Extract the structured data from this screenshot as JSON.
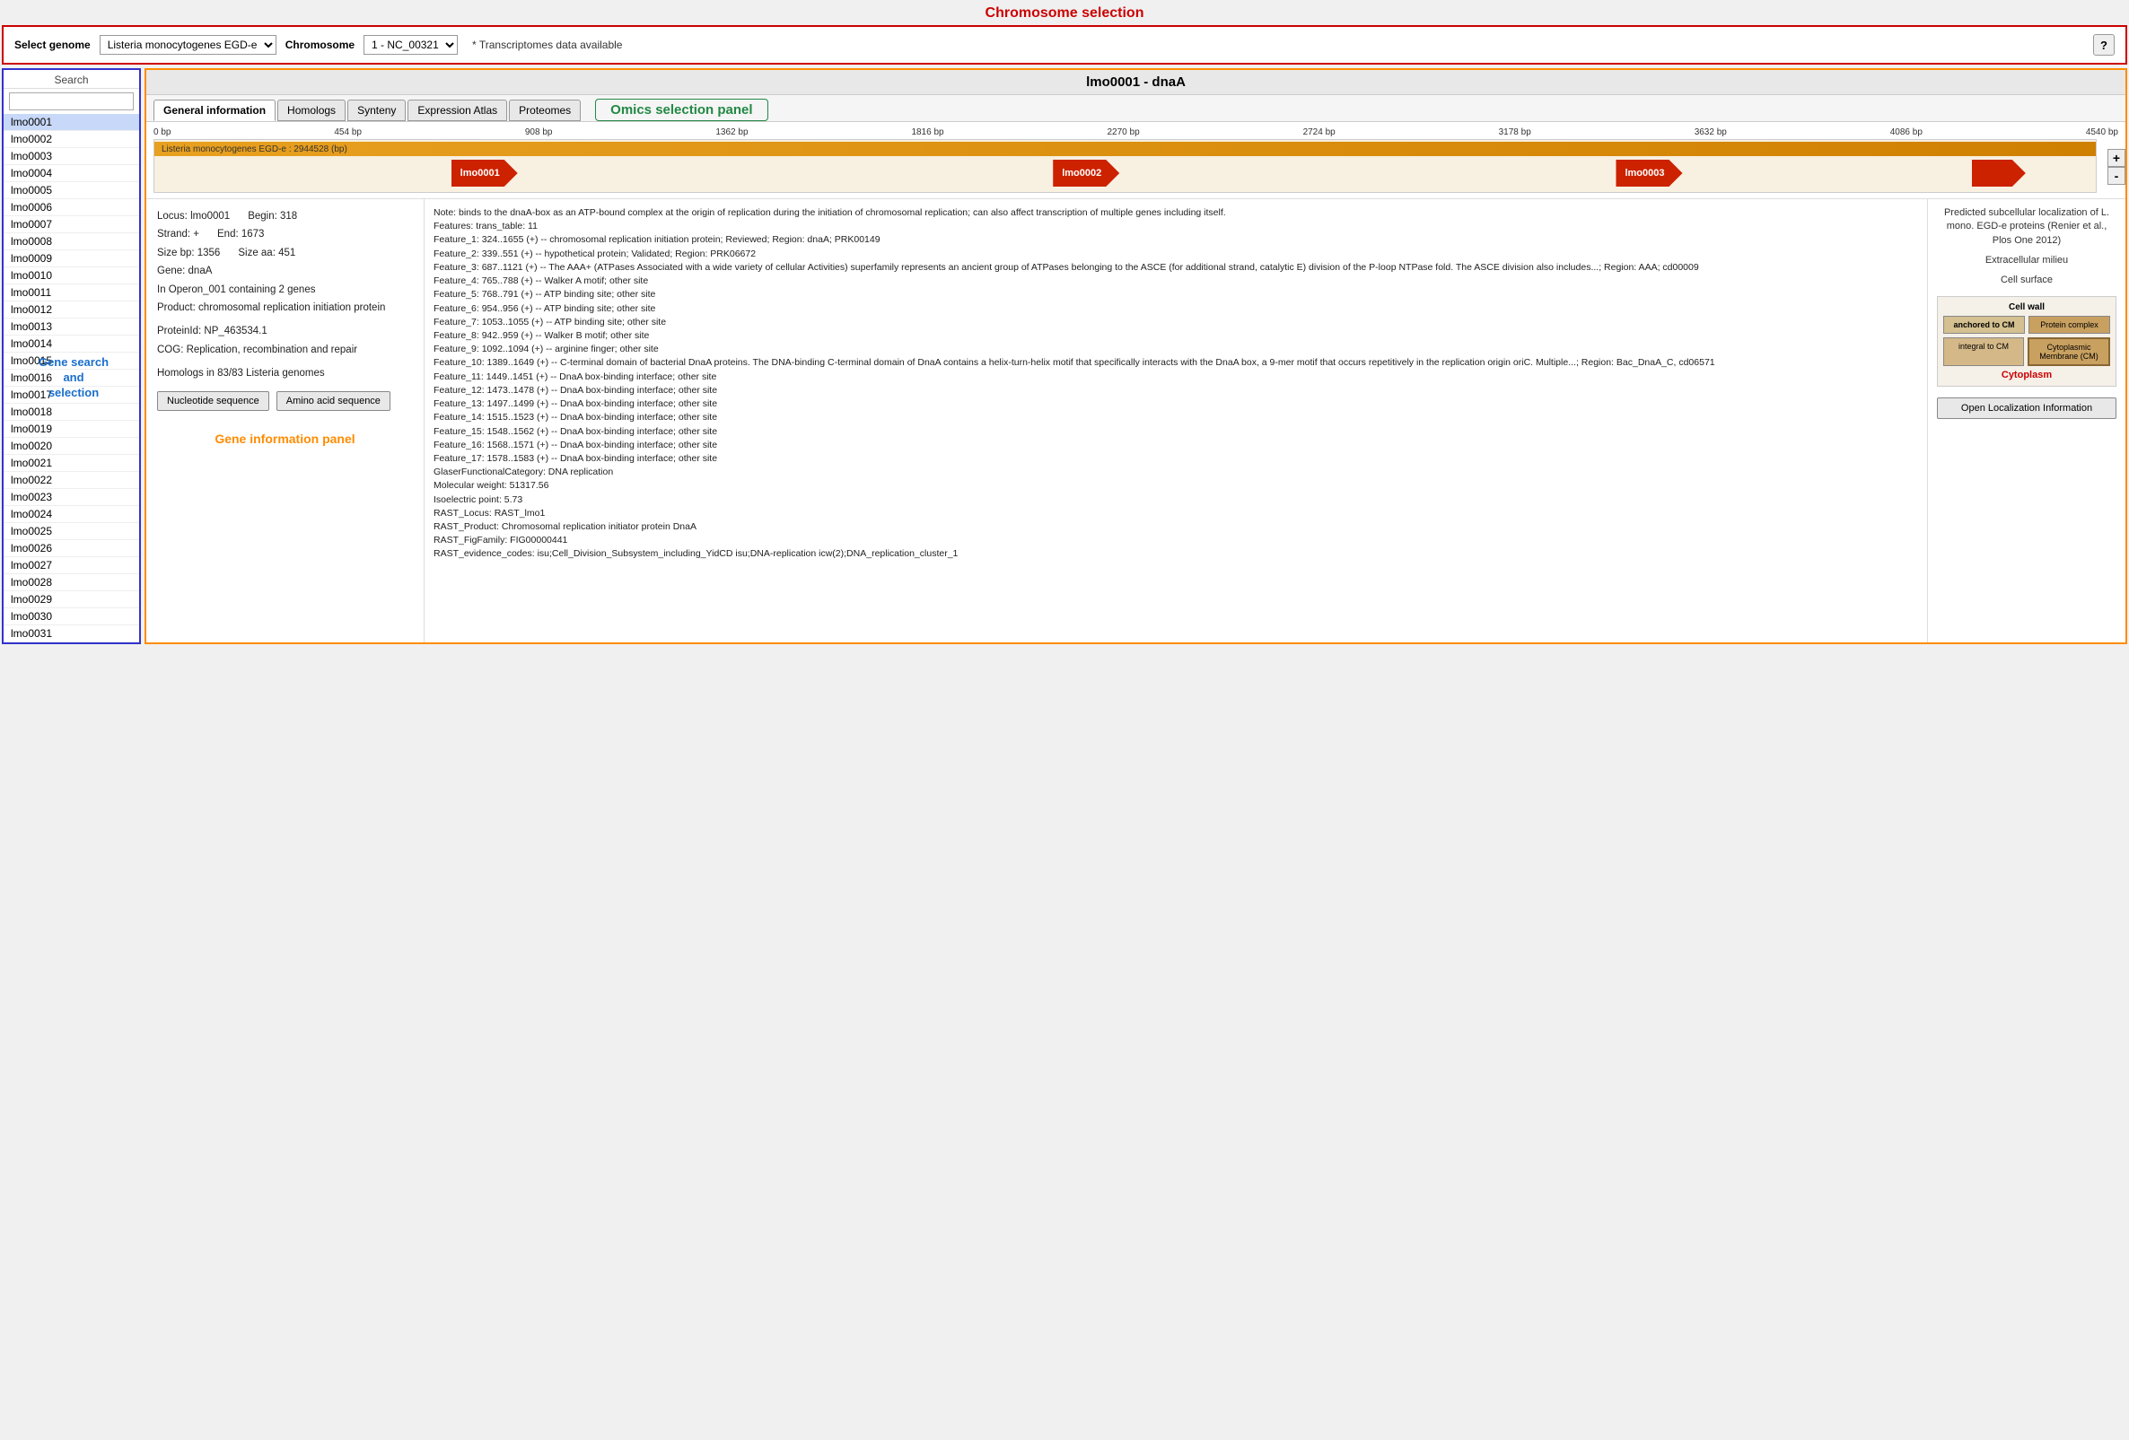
{
  "page": {
    "title": "Chromosome selection",
    "gene_title": "lmo0001 - dnaA"
  },
  "top_bar": {
    "select_genome_label": "Select genome",
    "genome_options": [
      "Listeria monocytogenes EGD-e"
    ],
    "genome_selected": "Listeria monocytogenes EGD-e",
    "chromosome_label": "Chromosome",
    "chromosome_options": [
      "1 - NC_00321"
    ],
    "chromosome_selected": "1 - NC_00321",
    "transcriptome_note": "* Transcriptomes data available",
    "help_btn": "?"
  },
  "sidebar": {
    "search_label": "Search",
    "search_placeholder": "",
    "genes": [
      "lmo0001",
      "lmo0002",
      "lmo0003",
      "lmo0004",
      "lmo0005",
      "lmo0006",
      "lmo0007",
      "lmo0008",
      "lmo0009",
      "lmo0010",
      "lmo0011",
      "lmo0012",
      "lmo0013",
      "lmo0014",
      "lmo0015",
      "lmo0016",
      "lmo0017",
      "lmo0018",
      "lmo0019",
      "lmo0020",
      "lmo0021",
      "lmo0022",
      "lmo0023",
      "lmo0024",
      "lmo0025",
      "lmo0026",
      "lmo0027",
      "lmo0028",
      "lmo0029",
      "lmo0030",
      "lmo0031"
    ],
    "annotation": "Gene search\nand\nselection"
  },
  "tabs": [
    {
      "id": "general",
      "label": "General information",
      "active": true
    },
    {
      "id": "homologs",
      "label": "Homologs",
      "active": false
    },
    {
      "id": "synteny",
      "label": "Synteny",
      "active": false
    },
    {
      "id": "expression",
      "label": "Expression Atlas",
      "active": false
    },
    {
      "id": "proteomes",
      "label": "Proteomes",
      "active": false
    }
  ],
  "omics_panel_label": "Omics selection panel",
  "genome_viewer": {
    "ruler_marks": [
      "0 bp",
      "454 bp",
      "908 bp",
      "1362 bp",
      "1816 bp",
      "2270 bp",
      "2724 bp",
      "3178 bp",
      "3632 bp",
      "4086 bp",
      "4540 bp"
    ],
    "genome_bar_label": "Listeria monocytogenes EGD-e : 2944528 (bp)",
    "genes": [
      {
        "id": "lmo0001",
        "label": "lmo0001",
        "left_pct": 3,
        "width_pct": 28
      },
      {
        "id": "lmo0002",
        "label": "lmo0002",
        "left_pct": 34,
        "width_pct": 28
      },
      {
        "id": "lmo0003",
        "label": "lmo0003",
        "left_pct": 65,
        "width_pct": 24
      },
      {
        "id": "lmo0004",
        "label": "",
        "left_pct": 91,
        "width_pct": 8
      }
    ],
    "zoom_plus": "+",
    "zoom_minus": "-"
  },
  "gene_info": {
    "locus": "Locus: lmo0001",
    "begin": "Begin: 318",
    "strand": "Strand: +",
    "end": "End: 1673",
    "size_bp": "Size bp: 1356",
    "size_aa": "Size aa: 451",
    "gene": "Gene: dnaA",
    "operon": "In Operon_001 containing 2 genes",
    "product": "Product: chromosomal replication initiation protein",
    "protein_id": "ProteinId: NP_463534.1",
    "cog": "COG: Replication, recombination and repair",
    "homologs": "Homologs in 83/83 Listeria genomes",
    "btn_nucleotide": "Nucleotide sequence",
    "btn_amino": "Amino acid sequence",
    "annotation_label": "Gene information panel"
  },
  "features_text": "Note: binds to the dnaA-box as an ATP-bound complex at the origin of replication during the initiation of chromosomal replication; can also affect transcription of multiple genes including itself.\nFeatures: trans_table: 11\nFeature_1: 324..1655 (+) -- chromosomal replication initiation protein; Reviewed; Region: dnaA; PRK00149\nFeature_2: 339..551 (+) -- hypothetical protein; Validated; Region: PRK06672\nFeature_3: 687..1121 (+) -- The AAA+ (ATPases Associated with a wide variety of cellular Activities) superfamily represents an ancient group of ATPases belonging to the ASCE (for additional strand, catalytic E) division of the P-loop NTPase fold. The ASCE division also includes...; Region: AAA; cd00009\nFeature_4: 765..788 (+) -- Walker A motif; other site\nFeature_5: 768..791 (+) -- ATP binding site; other site\nFeature_6: 954..956 (+) -- ATP binding site; other site\nFeature_7: 1053..1055 (+) -- ATP binding site; other site\nFeature_8: 942..959 (+) -- Walker B motif; other site\nFeature_9: 1092..1094 (+) -- arginine finger; other site\nFeature_10: 1389..1649 (+) -- C-terminal domain of bacterial DnaA proteins. The DNA-binding C-terminal domain of DnaA contains a helix-turn-helix motif that specifically interacts with the DnaA box, a 9-mer motif that occurs repetitively in the replication origin oriC. Multiple...; Region: Bac_DnaA_C, cd06571\nFeature_11: 1449..1451 (+) -- DnaA box-binding interface; other site\nFeature_12: 1473..1478 (+) -- DnaA box-binding interface; other site\nFeature_13: 1497..1499 (+) -- DnaA box-binding interface; other site\nFeature_14: 1515..1523 (+) -- DnaA box-binding interface; other site\nFeature_15: 1548..1562 (+) -- DnaA box-binding interface; other site\nFeature_16: 1568..1571 (+) -- DnaA box-binding interface; other site\nFeature_17: 1578..1583 (+) -- DnaA box-binding interface; other site\nGlaserFunctionalCategory: DNA replication\nMolecular weight: 51317.56\nIsoelectric point: 5.73\nRAST_Locus: RAST_lmo1\nRAST_Product: Chromosomal replication initiator protein DnaA\nRAST_FigFamily: FIG00000441\nRAST_evidence_codes: isu;Cell_Division_Subsystem_including_YidCD isu;DNA-replication icw(2);DNA_replication_cluster_1",
  "localization": {
    "title": "Predicted subcellular localization of L. mono. EGD-e proteins (Renier et al., Plos One 2012)",
    "extracellular": "Extracellular milieu",
    "cell_surface": "Cell surface",
    "cell_wall": "Cell wall",
    "anchored_to_cm": "anchored to CM",
    "protein_complex": "Protein complex",
    "integral_to_cm": "integral to CM",
    "cytoplasmic_membrane": "Cytoplasmic Membrane (CM)",
    "cytoplasm": "Cytoplasm",
    "open_btn": "Open Localization Information"
  }
}
